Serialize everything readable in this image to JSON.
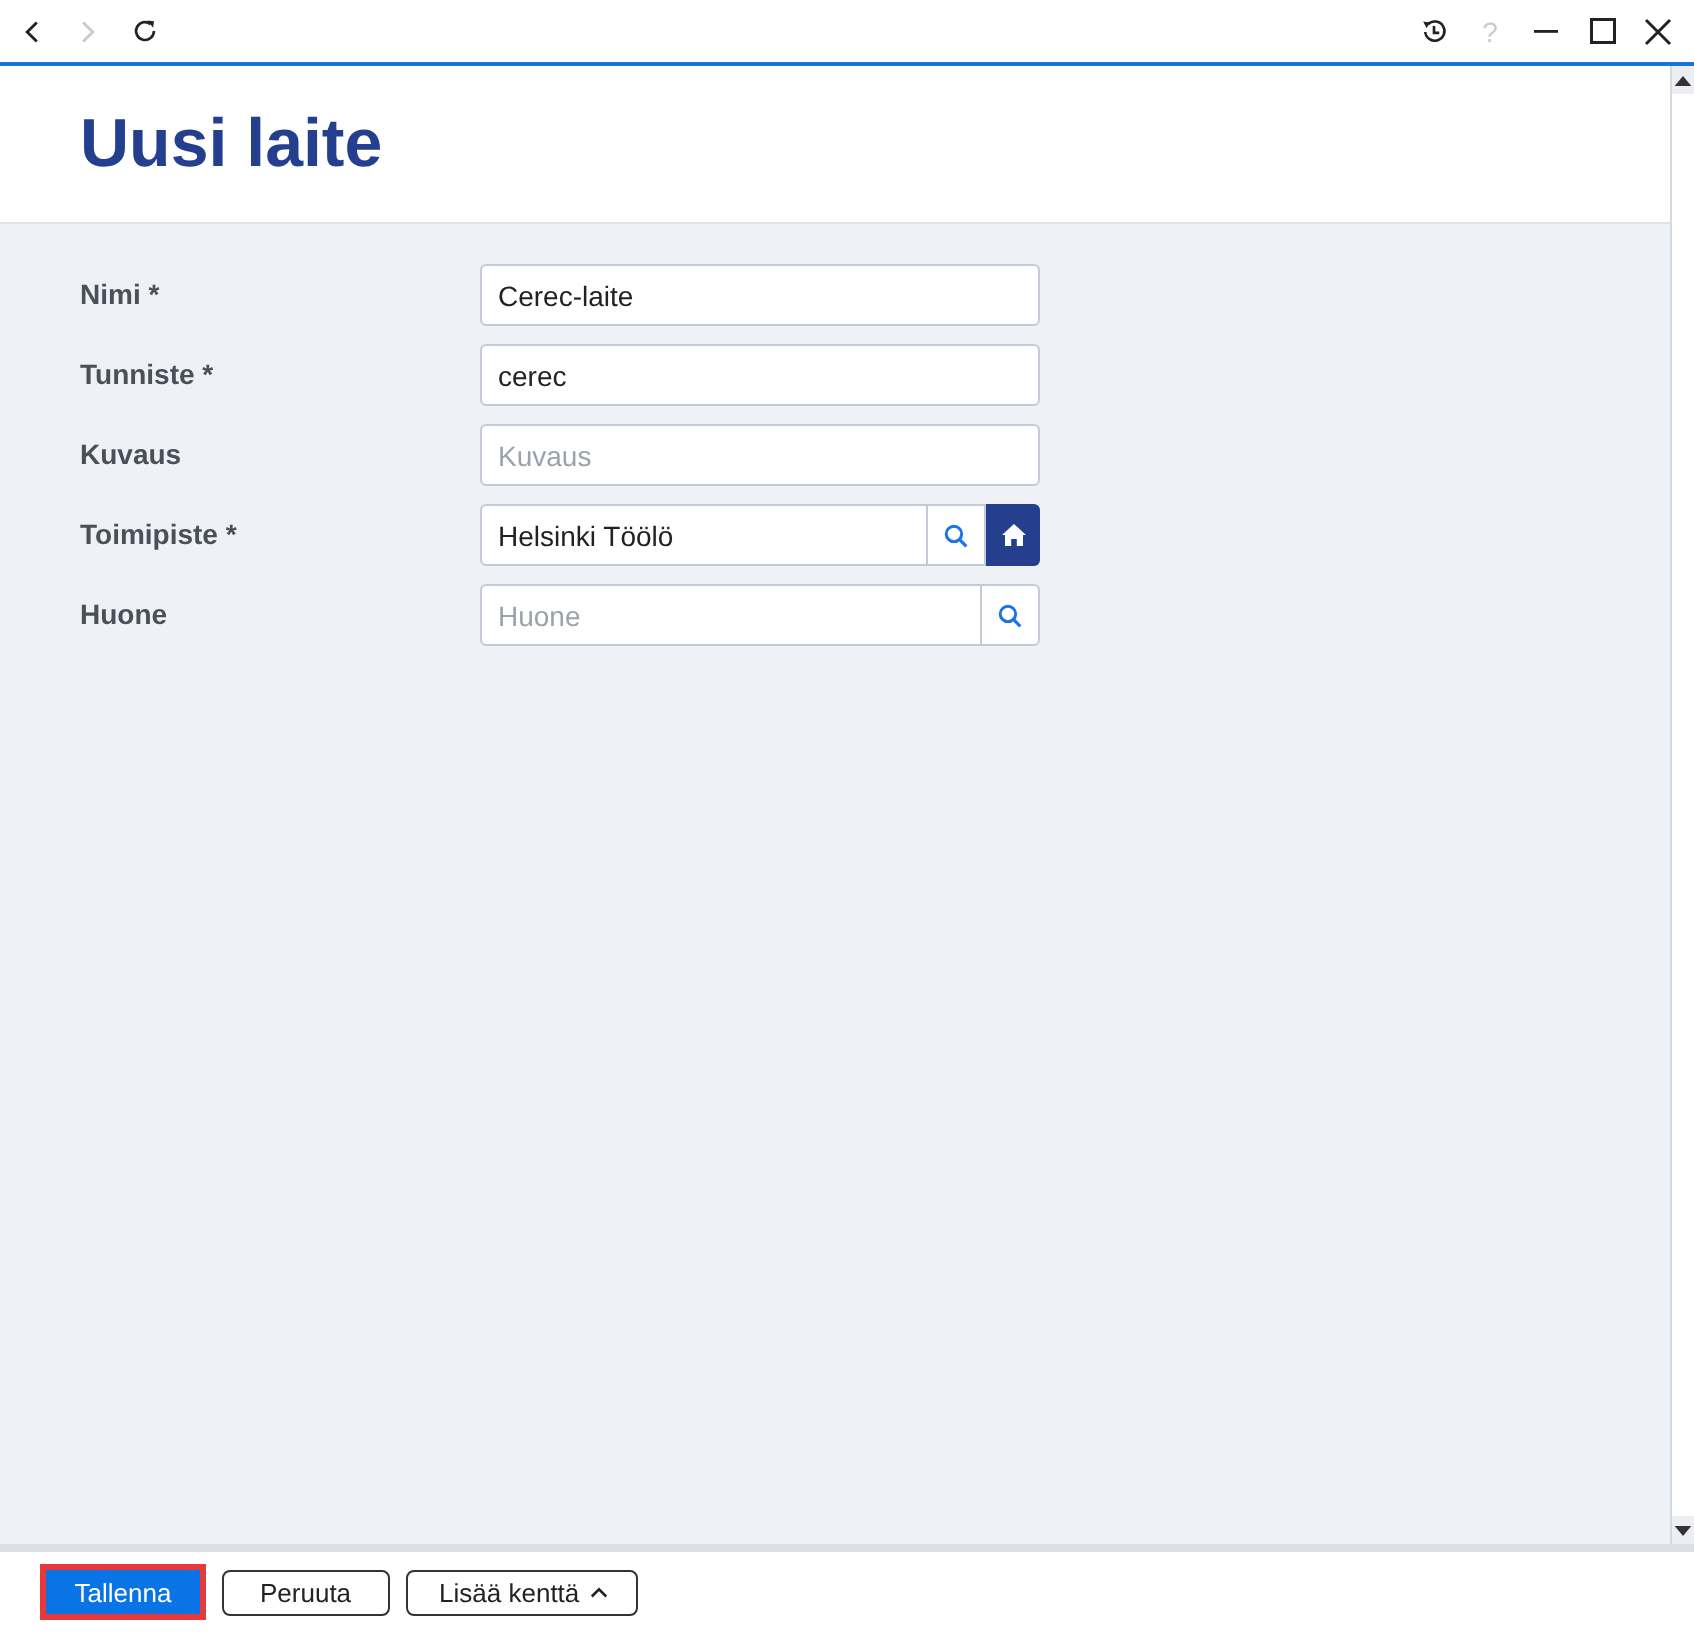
{
  "toolbar": {
    "nav": [
      {
        "kind": "back",
        "disabled": false
      },
      {
        "kind": "forward",
        "disabled": true
      },
      {
        "kind": "reload",
        "disabled": false
      }
    ],
    "window_controls": [
      {
        "kind": "history",
        "disabled": false
      },
      {
        "kind": "help",
        "label": "?",
        "disabled": true
      },
      {
        "kind": "minimize",
        "disabled": false
      },
      {
        "kind": "maximize",
        "disabled": false
      },
      {
        "kind": "close",
        "disabled": false
      }
    ]
  },
  "title": "Uusi laite",
  "form": {
    "fields": [
      {
        "label": "Nimi *",
        "kind": "text",
        "value": "Cerec-laite"
      },
      {
        "label": "Tunniste *",
        "kind": "text",
        "value": "cerec"
      },
      {
        "label": "Kuvaus",
        "kind": "text",
        "placeholder": "Kuvaus"
      },
      {
        "label": "Toimipiste *",
        "kind": "lookup_home",
        "value": "Helsinki Töölö"
      },
      {
        "label": "Huone",
        "kind": "lookup",
        "placeholder": "Huone"
      }
    ]
  },
  "footer": {
    "buttons": [
      {
        "label": "Tallenna",
        "kind": "primary",
        "highlighted": true
      },
      {
        "label": "Peruuta",
        "kind": "secondary",
        "highlighted": false
      },
      {
        "label": "Lisää kenttä",
        "kind": "dropdown",
        "highlighted": false
      }
    ]
  }
}
